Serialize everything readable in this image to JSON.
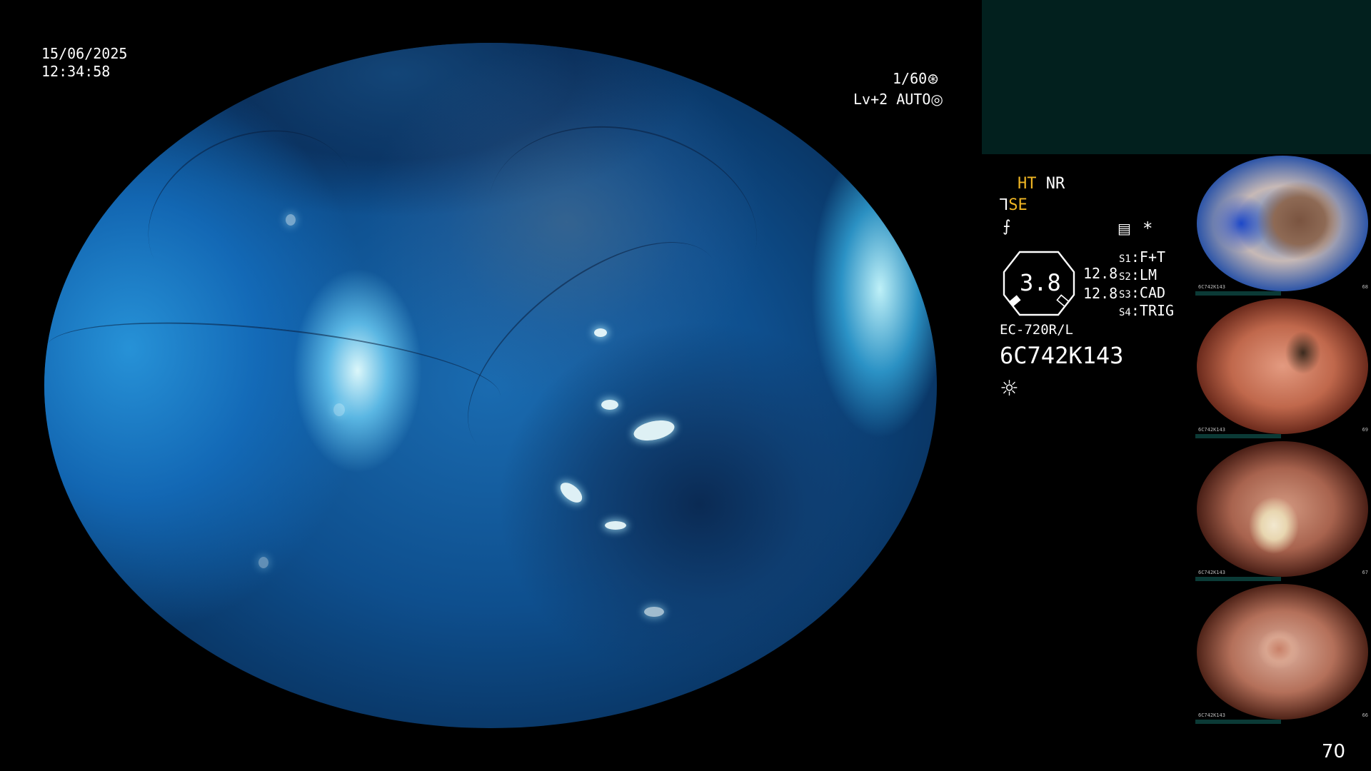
{
  "timestamp": {
    "date": "15/06/2025",
    "time": "12:34:58"
  },
  "exposure": {
    "shutter": "1/60",
    "shutter_icon": "shutter-icon",
    "level": "Lv+2",
    "mode": "AUTO",
    "mode_icon": "auto-iris-icon"
  },
  "settings": {
    "ht": "HT",
    "nr": "NR",
    "se": "SE",
    "se_icon": "structure-enhance-icon",
    "color_icon": "color-mode-icon",
    "memory_icon": "memory-card-icon",
    "asterisk": "*"
  },
  "gauge": {
    "value": "3.8",
    "side_values": [
      "12.8",
      "12.8"
    ]
  },
  "switches": [
    {
      "key": "S1",
      "value": "F+T"
    },
    {
      "key": "S2",
      "value": "LM"
    },
    {
      "key": "S3",
      "value": "CAD"
    },
    {
      "key": "S4",
      "value": "TRIG"
    }
  ],
  "scope": {
    "model": "EC-720R/L",
    "serial": "6C742K143",
    "light_icon": "light-icon"
  },
  "thumbnails": [
    {
      "name": "thumbnail-1",
      "label": "6C742K143",
      "index": "68"
    },
    {
      "name": "thumbnail-2",
      "label": "6C742K143",
      "index": "69"
    },
    {
      "name": "thumbnail-3",
      "label": "6C742K143",
      "index": "67"
    },
    {
      "name": "thumbnail-4",
      "label": "6C742K143",
      "index": "66"
    }
  ],
  "frame_count": "70",
  "colors": {
    "accent": "#f0b624",
    "panel": "#02201e",
    "background": "#000000"
  }
}
